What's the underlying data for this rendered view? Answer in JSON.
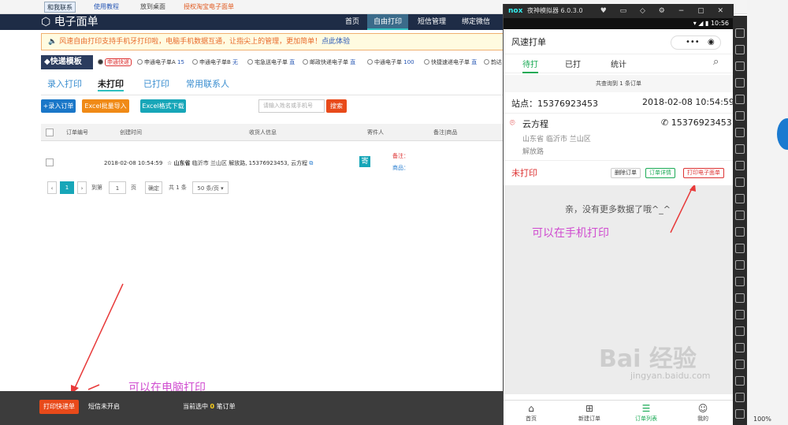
{
  "browser_bar": {
    "items": [
      "和我联系",
      "使用教程",
      "放到桌面",
      "授权淘宝电子面单"
    ]
  },
  "app": {
    "title": "电子面单",
    "nav": [
      "首页",
      "自由打印",
      "短信管理",
      "绑定微信"
    ],
    "active_nav": "自由打印"
  },
  "notice": {
    "text": "风速自由打印支持手机",
    "text2": "牙打印啦，电脑手机数据互通，让指尖上的管理，更加简单！",
    "link": "点此体验"
  },
  "template_bar": {
    "label": "快递模板",
    "options": [
      {
        "name": "申通快递",
        "count": ""
      },
      {
        "name": "申通电子单A",
        "count": "15"
      },
      {
        "name": "申通电子单B",
        "count": "无"
      },
      {
        "name": "宅急送电子单",
        "count": "直"
      },
      {
        "name": "邮政快递电子单",
        "count": "直"
      },
      {
        "name": "中通电子单",
        "count": "100"
      },
      {
        "name": "快捷速递电子单",
        "count": "直"
      },
      {
        "name": "韵达",
        "count": ""
      }
    ]
  },
  "tabs": [
    "录入打印",
    "未打印",
    "已打印",
    "常用联系人"
  ],
  "toolbar": {
    "add": "+录入订单",
    "import": "Excel批量导入",
    "download": "Excel格式下载",
    "search_placeholder": "请输入姓名或手机号",
    "search": "搜索"
  },
  "table": {
    "headers": [
      "订单编号",
      "创建时间",
      "收货人信息",
      "寄件人",
      "备注|商品"
    ],
    "row": {
      "time": "2018-02-08 10:54:59",
      "province": "山东省",
      "addr": "临沂市 兰山区 解放路, 15376923453, 云方程",
      "sender_badge": "寄",
      "note": "备注：",
      "goods": "商品："
    }
  },
  "pager": {
    "page": "1",
    "goto": "到第",
    "page_input": "1",
    "page_unit": "页",
    "confirm": "确定",
    "total": "共 1 条",
    "per_page": "50 条/页 ▾"
  },
  "footer": {
    "print_button": "打印快递单",
    "sms": "短信未开启",
    "selected_prefix": "当前选中",
    "selected_count": "0",
    "selected_suffix": "笔订单"
  },
  "annotations": {
    "pc": "可以在电脑打印",
    "mobile": "可以在手机打印"
  },
  "emulator": {
    "brand": "nox",
    "title": "夜神模拟器 6.0.3.0",
    "controls": "♥ ▭ ◇ ⚙ − ▢ ✕",
    "clock": "10:56",
    "app_title": "风速打单",
    "tabs": [
      "待打",
      "已打",
      "统计"
    ],
    "count_text": "共查询到 1 条订单",
    "station": "站点：15376923453",
    "station_time": "2018-02-08 10:54:59",
    "receiver": "云方程",
    "receiver_phone": "15376923453",
    "address1": "山东省 临沂市 兰山区",
    "address2": "解放路",
    "status": "未打印",
    "buttons": [
      "删除订单",
      "订单详情",
      "打印电子面单"
    ],
    "no_more": "亲，没有更多数据了哦^_^",
    "nav": [
      "首页",
      "新建订单",
      "订单列表",
      "我的"
    ],
    "active_nav": "订单列表"
  },
  "side_zoom": "100%",
  "watermark": "Bai 经验",
  "watermark2": "jingyan.baidu.com"
}
